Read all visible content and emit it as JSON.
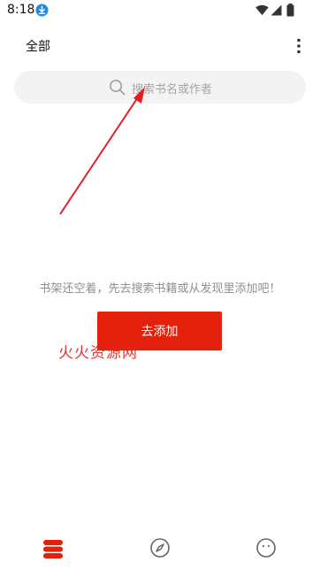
{
  "status_bar": {
    "time": "8:18",
    "icons": [
      "download-icon",
      "wifi-icon",
      "signal-icon",
      "battery-icon"
    ]
  },
  "header": {
    "title": "全部",
    "menu_icon": "more-vert-icon"
  },
  "search": {
    "placeholder": "搜索书名或作者",
    "icon": "search-icon"
  },
  "empty_state": {
    "message": "书架还空着，先去搜索书籍或从发现里添加吧！",
    "button_label": "去添加"
  },
  "watermark": "火火资源网",
  "bottom_nav": {
    "items": [
      {
        "name": "bookshelf",
        "icon": "bookshelf-icon",
        "active": true
      },
      {
        "name": "discover",
        "icon": "compass-icon",
        "active": false
      },
      {
        "name": "profile",
        "icon": "smiley-icon",
        "active": false
      }
    ]
  },
  "colors": {
    "accent": "#e4210d",
    "annotation": "#e0261f",
    "search_bg": "#f3f3f3",
    "placeholder": "#a5a5a5",
    "muted_text": "#8f8f8f",
    "nav_icon": "#666666"
  }
}
